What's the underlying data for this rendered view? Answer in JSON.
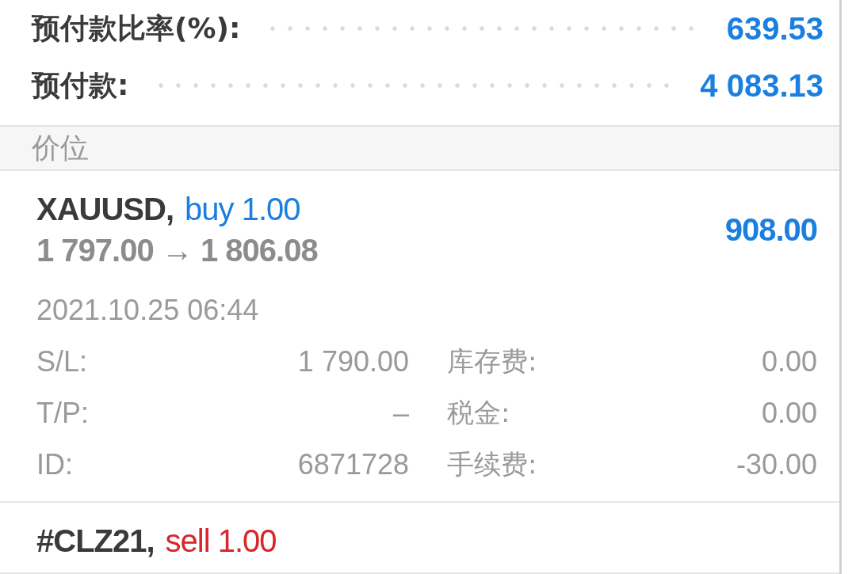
{
  "summary": [
    {
      "label": "预付款比率(%):",
      "value": "639.53"
    },
    {
      "label": "预付款:",
      "value": "4 083.13"
    }
  ],
  "section": {
    "title": "价位"
  },
  "positions": [
    {
      "symbol": "XAUUSD,",
      "color": "#1a7fe0",
      "order": "buy 1.00",
      "prices": "1 797.00 → 1 806.08",
      "profit": "908.00",
      "time": "2021.10.25 06:44",
      "fields": [
        {
          "label": "S/L:",
          "value": "1 790.00",
          "label2": "库存费:",
          "value2": "0.00"
        },
        {
          "label": "T/P:",
          "value": "–",
          "label2": "税金:",
          "value2": "0.00"
        },
        {
          "label": "ID:",
          "value": "6871728",
          "label2": "手续费:",
          "value2": "-30.00"
        }
      ]
    },
    {
      "symbol": "#CLZ21,",
      "color": "#d8262b",
      "order": "sell 1.00"
    }
  ]
}
